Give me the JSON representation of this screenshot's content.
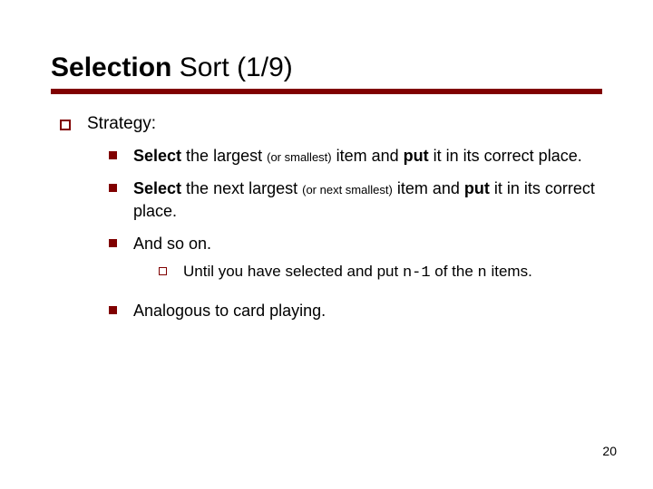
{
  "title": {
    "bold": "Selection",
    "rest": " Sort (1/9)"
  },
  "heading": "Strategy:",
  "items": [
    {
      "seg1_b": "Select",
      "seg2": " the largest ",
      "seg3_small": "(or smallest)",
      "seg4": " item and ",
      "seg5_b": "put",
      "seg6": " it in its correct place."
    },
    {
      "seg1_b": "Select",
      "seg2": " the next largest ",
      "seg3_small": "(or next smallest)",
      "seg4": " item and ",
      "seg5_b": "put",
      "seg6": " it in its correct place."
    },
    {
      "plain": "And so on.",
      "sub": {
        "pre": "Until you have selected and put ",
        "code1": "n-1",
        "mid": " of the ",
        "code2": "n",
        "post": " items."
      }
    },
    {
      "plain": "Analogous to card playing."
    }
  ],
  "page_number": "20"
}
